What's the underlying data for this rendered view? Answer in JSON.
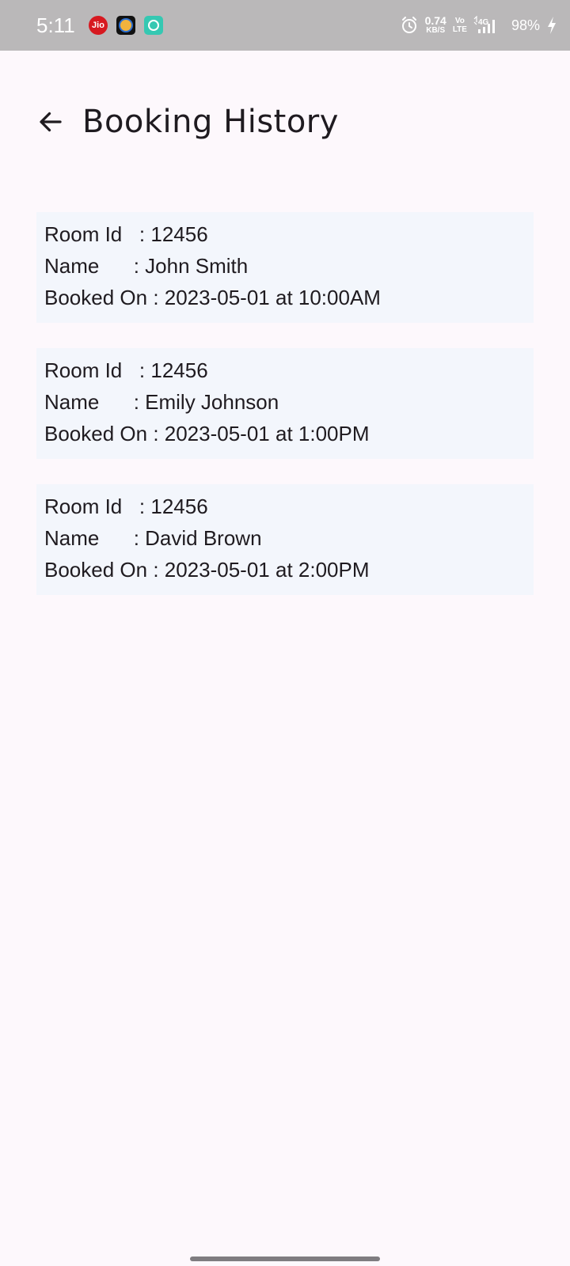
{
  "status_bar": {
    "time": "5:11",
    "jio_label": "Jio",
    "net_speed_value": "0.74",
    "net_speed_unit": "KB/S",
    "volte_top": "Vo",
    "volte_bottom": "LTE",
    "network_label": "4G",
    "battery": "98%"
  },
  "header": {
    "back_icon": "arrow-left-icon",
    "title": "Booking History"
  },
  "bookings": [
    {
      "room_line": "Room Id   : 12456",
      "name_line": "Name      : John Smith",
      "booked_line": "Booked On : 2023-05-01 at 10:00AM"
    },
    {
      "room_line": "Room Id   : 12456",
      "name_line": "Name      : Emily Johnson",
      "booked_line": "Booked On : 2023-05-01 at 1:00PM"
    },
    {
      "room_line": "Room Id   : 12456",
      "name_line": "Name      : David Brown",
      "booked_line": "Booked On : 2023-05-01 at 2:00PM"
    }
  ],
  "colors": {
    "status_bar_bg": "#bab8b9",
    "page_bg": "#fdf8fc",
    "card_bg": "#f3f6fc",
    "text": "#1f1b20"
  }
}
